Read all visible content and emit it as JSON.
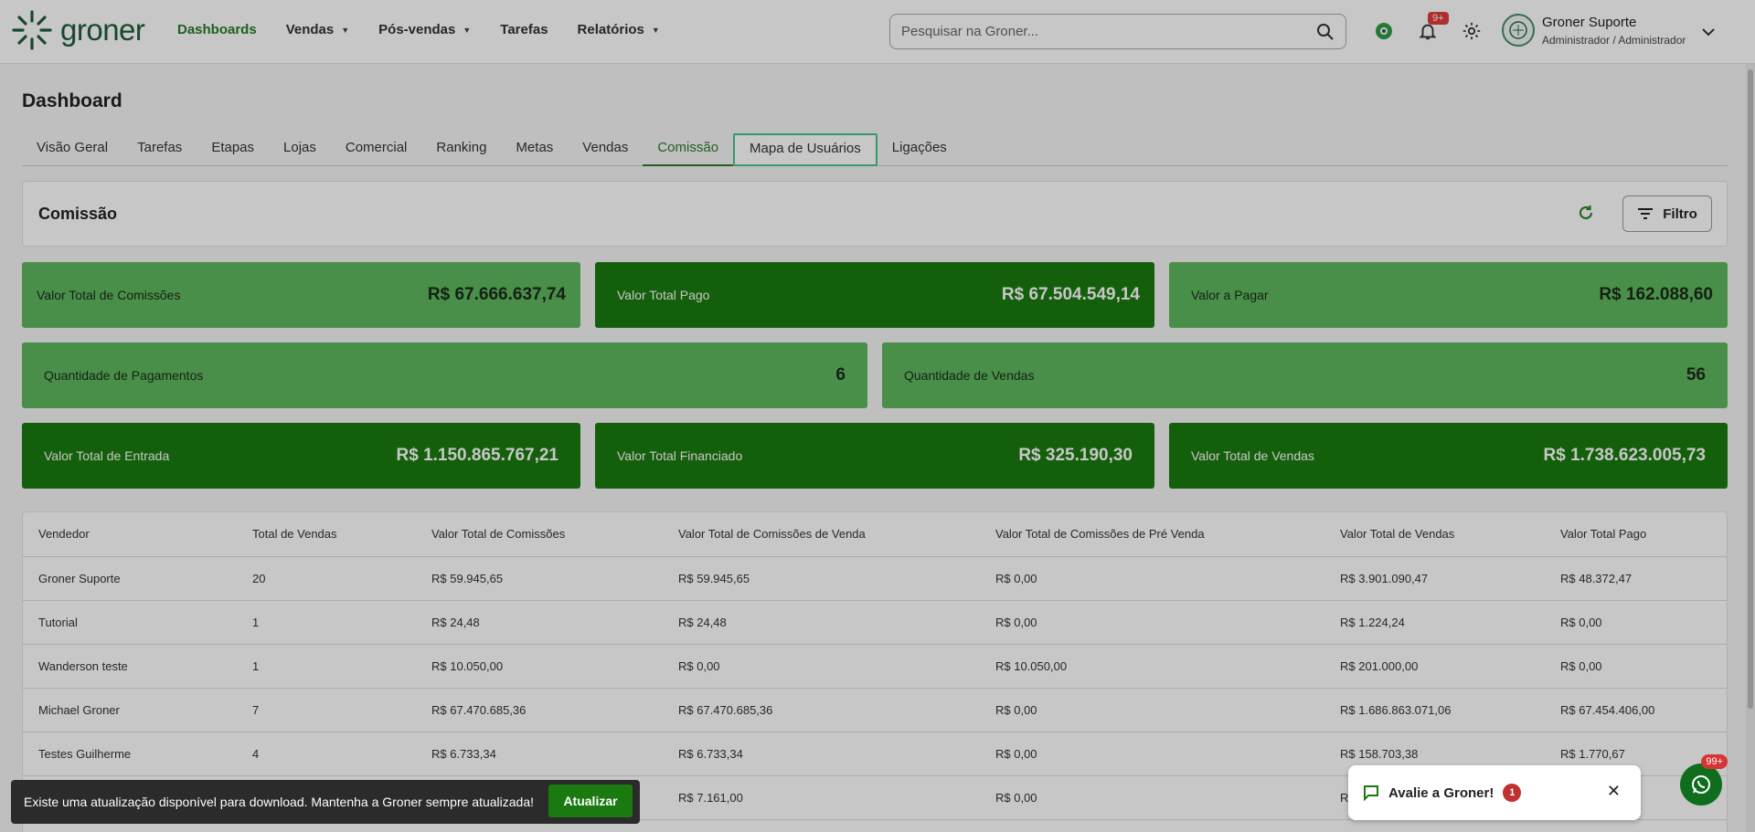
{
  "topbar": {
    "logo": "groner",
    "nav": [
      {
        "label": "Dashboards",
        "active": true,
        "dropdown": false
      },
      {
        "label": "Vendas",
        "dropdown": true
      },
      {
        "label": "Pós-vendas",
        "dropdown": true
      },
      {
        "label": "Tarefas",
        "dropdown": false
      },
      {
        "label": "Relatórios",
        "dropdown": true
      }
    ],
    "search_placeholder": "Pesquisar na Groner...",
    "notifications_badge": "9+",
    "user_name": "Groner Suporte",
    "user_role": "Administrador / Administrador"
  },
  "page": {
    "title": "Dashboard",
    "tabs": [
      "Visão Geral",
      "Tarefas",
      "Etapas",
      "Lojas",
      "Comercial",
      "Ranking",
      "Metas",
      "Vendas",
      "Comissão",
      "Mapa de Usuários",
      "Ligações"
    ],
    "active_tab": "Comissão",
    "hovered_tab": "Mapa de Usuários"
  },
  "section": {
    "title": "Comissão",
    "filter_label": "Filtro"
  },
  "cards": [
    {
      "label": "Valor Total de Comissões",
      "value": "R$ 67.666.637,74"
    },
    {
      "label": "Valor Total Pago",
      "value": "R$ 67.504.549,14"
    },
    {
      "label": "Valor a Pagar",
      "value": "R$ 162.088,60"
    },
    {
      "label": "Quantidade de Pagamentos",
      "value": "6"
    },
    {
      "label": "Quantidade de Vendas",
      "value": "56"
    },
    {
      "label": "Valor Total de Entrada",
      "value": "R$ 1.150.865.767,21"
    },
    {
      "label": "Valor Total Financiado",
      "value": "R$ 325.190,30"
    },
    {
      "label": "Valor Total de Vendas",
      "value": "R$ 1.738.623.005,73"
    }
  ],
  "colors": {
    "brand": "#1a7a10",
    "light_card": "#5eb85e",
    "accent": "#2a7a2a"
  },
  "table": {
    "headers": [
      "Vendedor",
      "Total de Vendas",
      "Valor Total de Comissões",
      "Valor Total de Comissões de Venda",
      "Valor Total de Comissões de Pré Venda",
      "Valor Total de Vendas",
      "Valor Total Pago"
    ],
    "rows": [
      [
        "Groner Suporte",
        "20",
        "R$ 59.945,65",
        "R$ 59.945,65",
        "R$ 0,00",
        "R$ 3.901.090,47",
        "R$ 48.372,47"
      ],
      [
        "Tutorial",
        "1",
        "R$ 24,48",
        "R$ 24,48",
        "R$ 0,00",
        "R$ 1.224,24",
        "R$ 0,00"
      ],
      [
        "Wanderson teste",
        "1",
        "R$ 10.050,00",
        "R$ 0,00",
        "R$ 10.050,00",
        "R$ 201.000,00",
        "R$ 0,00"
      ],
      [
        "Michael Groner",
        "7",
        "R$ 67.470.685,36",
        "R$ 67.470.685,36",
        "R$ 0,00",
        "R$ 1.686.863.071,06",
        "R$ 67.454.406,00"
      ],
      [
        "Testes Guilherme",
        "4",
        "R$ 6.733,34",
        "R$ 6.733,34",
        "R$ 0,00",
        "R$ 158.703,38",
        "R$ 1.770,67"
      ],
      [
        "",
        "",
        "",
        "R$ 7.161,00",
        "R$ 0,00",
        "R",
        ""
      ]
    ]
  },
  "toast": {
    "message": "Existe uma atualização disponível para download. Mantenha a Groner sempre atualizada!",
    "button": "Atualizar"
  },
  "rate_widget": {
    "label": "Avalie a Groner!",
    "count": "1"
  },
  "whatsapp_badge": "99+"
}
